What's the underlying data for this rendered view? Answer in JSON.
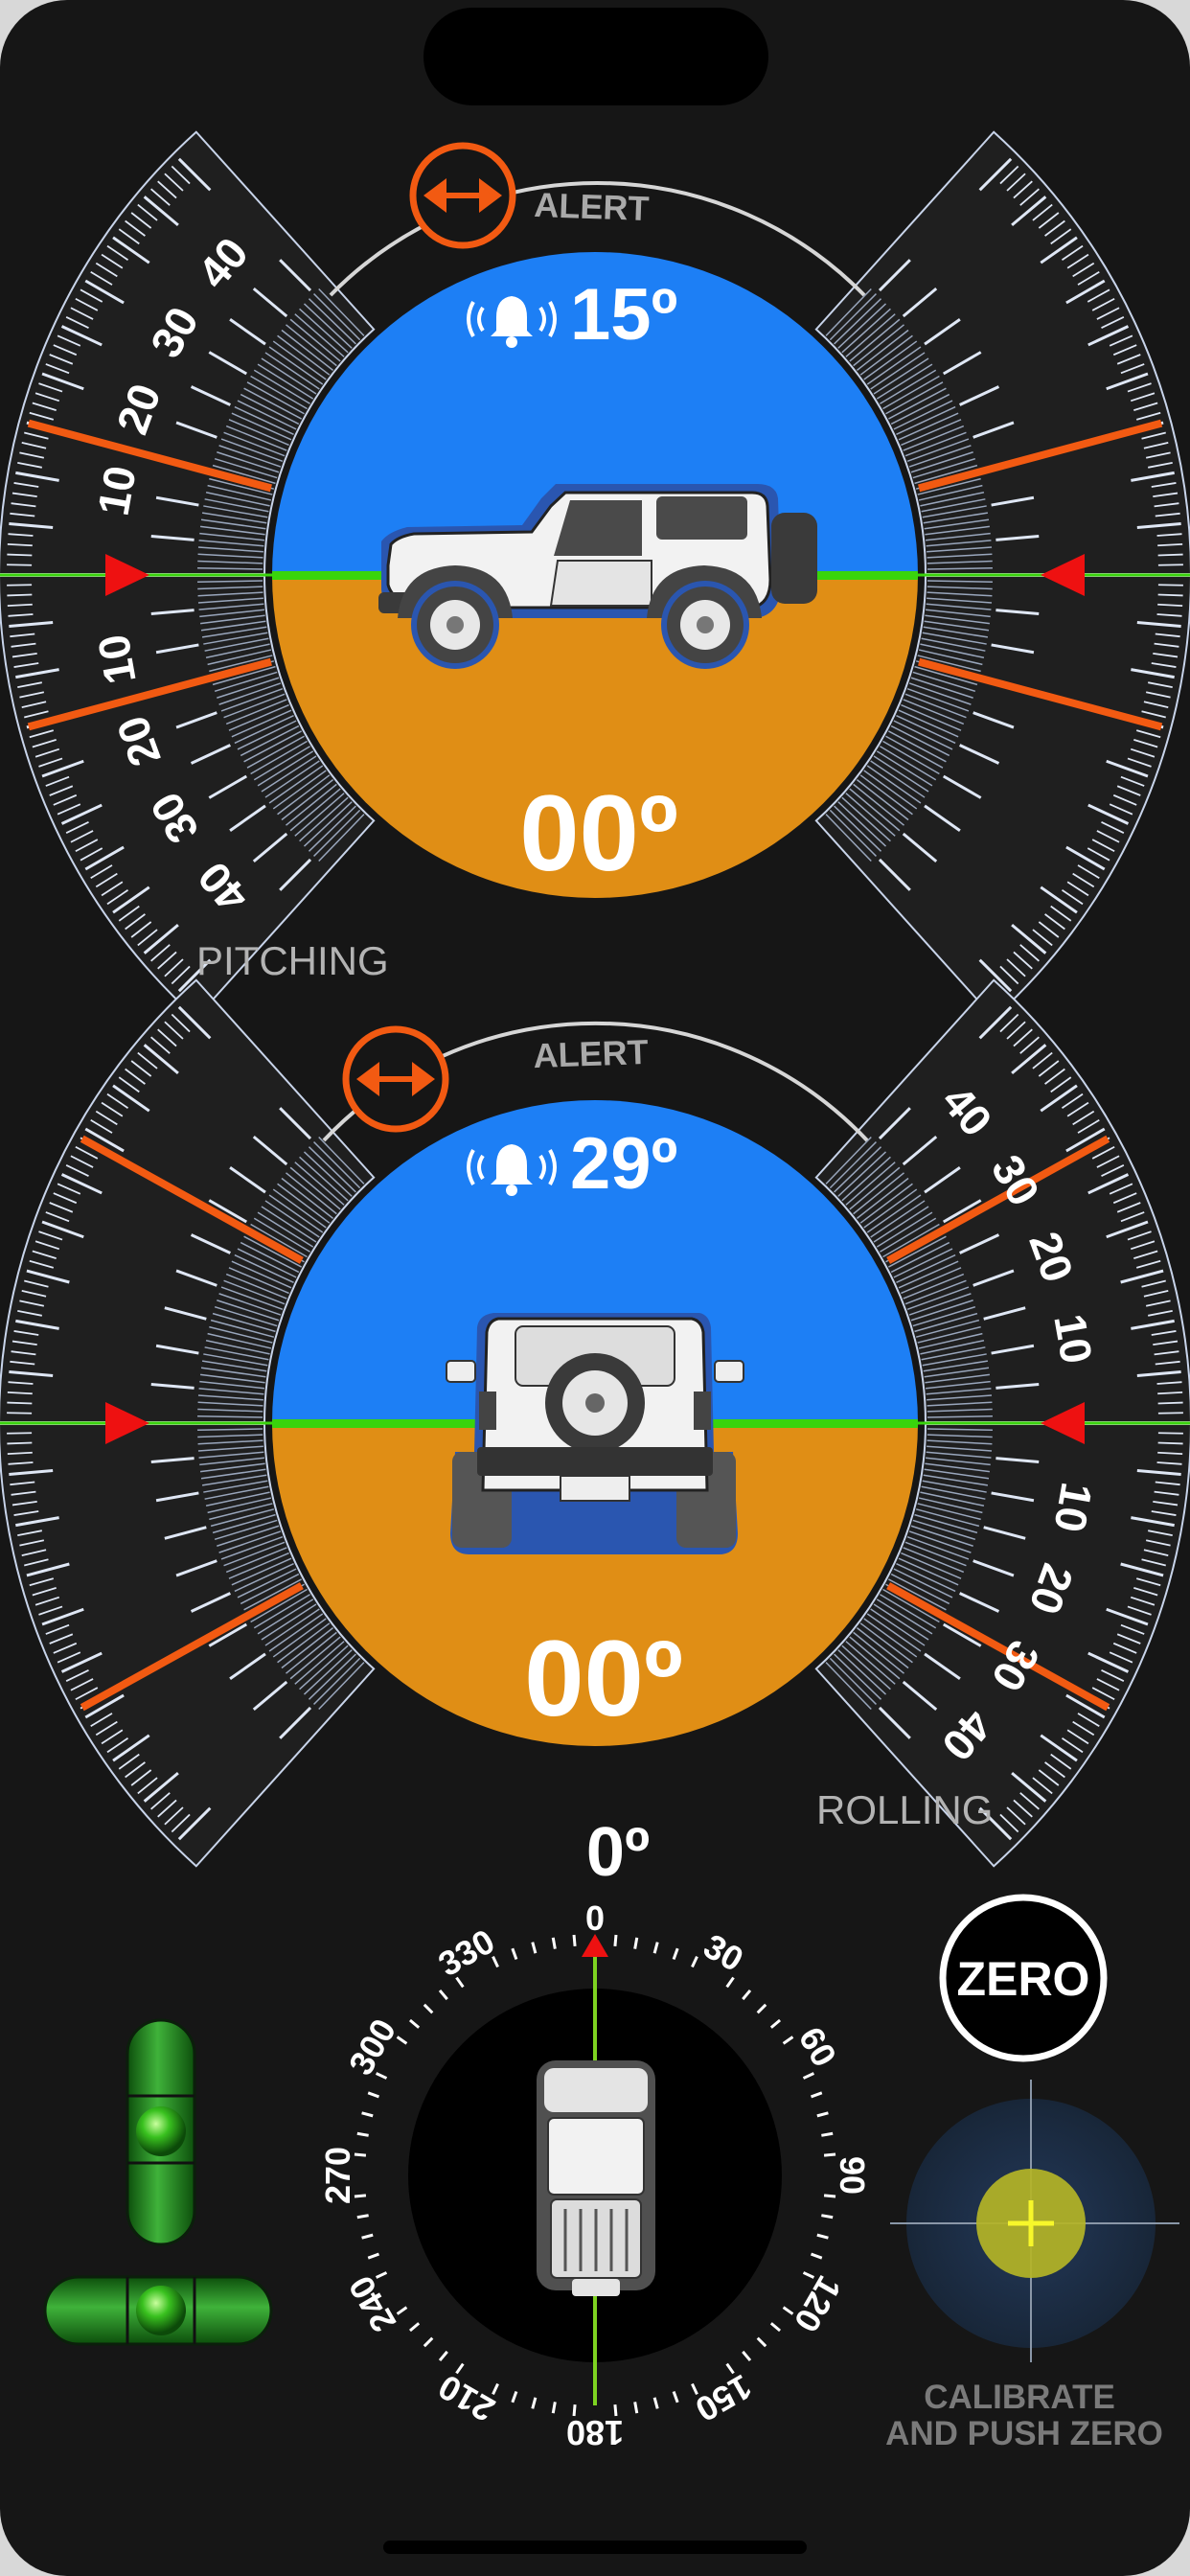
{
  "colors": {
    "screen_bg": "#161616",
    "sky": "#1d7ff5",
    "ground": "#e08e15",
    "horizon": "#39d40c",
    "alert_orange": "#f25a12",
    "marker_red": "#ee1111",
    "scale_white": "#ffffff",
    "bubble_green": "#2e9a2c",
    "cal_blue": "#1d2d44",
    "cal_yellow": "#b4b426"
  },
  "pitch_gauge": {
    "alert_label": "ALERT",
    "alert_threshold": "15º",
    "current_angle": "00º",
    "mode_label": "PITCHING",
    "alert_icon": "left-right-arrow-icon",
    "bell_icon": "bell-ringing-icon",
    "tick_labels": [
      "40",
      "30",
      "20",
      "10",
      "10",
      "20",
      "30",
      "40"
    ],
    "vehicle_view": "side"
  },
  "roll_gauge": {
    "alert_label": "ALERT",
    "alert_threshold": "29º",
    "current_angle": "00º",
    "mode_label": "ROLLING",
    "alert_icon": "left-right-arrow-icon",
    "bell_icon": "bell-ringing-icon",
    "tick_labels": [
      "40",
      "30",
      "20",
      "10",
      "10",
      "20",
      "30",
      "40"
    ],
    "vehicle_view": "rear"
  },
  "compass": {
    "heading": "0º",
    "labels": [
      "0",
      "30",
      "60",
      "90",
      "120",
      "150",
      "180",
      "210",
      "240",
      "270",
      "300",
      "330"
    ],
    "heading_value": 0
  },
  "zero_button": {
    "label": "ZERO"
  },
  "calibrate": {
    "line1": "CALIBRATE",
    "line2": "AND PUSH ZERO"
  }
}
